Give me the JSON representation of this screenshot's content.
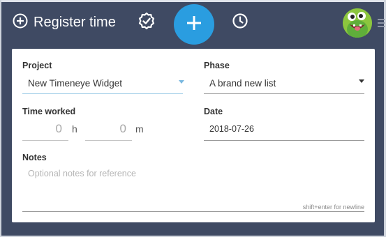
{
  "header": {
    "register_label": "Register time",
    "icons": {
      "register": "plus-circle-icon",
      "check": "check-badge-icon",
      "add": "plus-icon",
      "history": "clock-icon",
      "avatar": "user-avatar"
    }
  },
  "form": {
    "project": {
      "label": "Project",
      "value": "New Timeneye Widget"
    },
    "phase": {
      "label": "Phase",
      "value": "A brand new list"
    },
    "time_worked": {
      "label": "Time worked",
      "hours_placeholder": "0",
      "hours_unit": "h",
      "minutes_placeholder": "0",
      "minutes_unit": "m"
    },
    "date": {
      "label": "Date",
      "value": "2018-07-26"
    },
    "notes": {
      "label": "Notes",
      "placeholder": "Optional notes for reference",
      "hint": "shift+enter for newline"
    }
  },
  "colors": {
    "background": "#3f4a63",
    "accent": "#2a9de0",
    "card": "#ffffff"
  }
}
